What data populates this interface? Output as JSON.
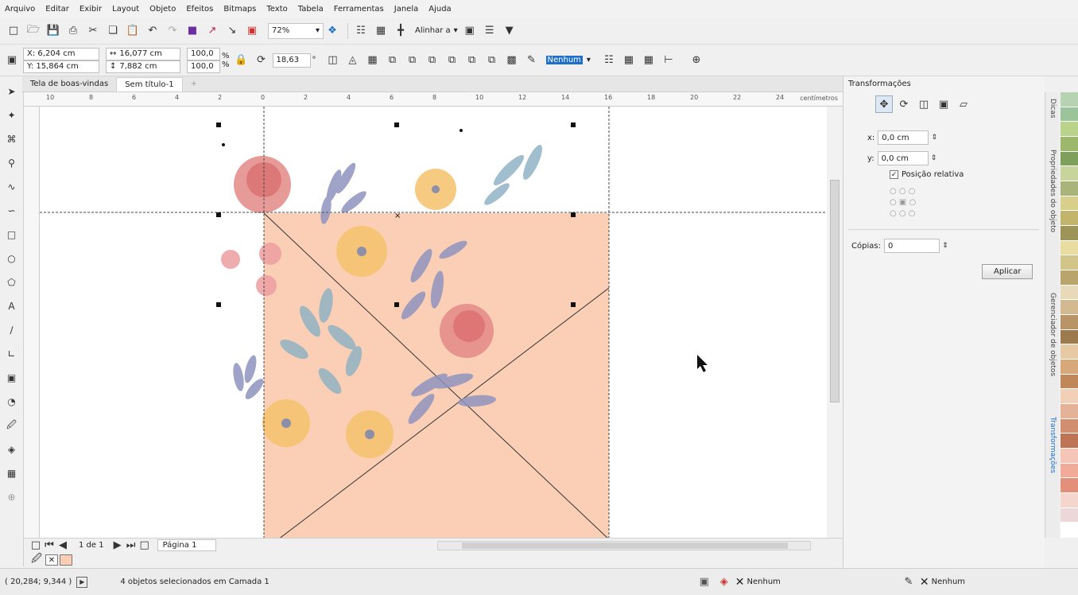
{
  "menu": [
    "Arquivo",
    "Editar",
    "Exibir",
    "Layout",
    "Objeto",
    "Efeitos",
    "Bitmaps",
    "Texto",
    "Tabela",
    "Ferramentas",
    "Janela",
    "Ajuda"
  ],
  "toolbar": {
    "zoom": "72%",
    "snap_label": "Alinhar a"
  },
  "props": {
    "x": "X: 6,204 cm",
    "y": "Y: 15,864 cm",
    "w": "16,077 cm",
    "h": "7,882 cm",
    "scale_w": "100,0",
    "scale_h": "100,0",
    "pct": "%",
    "rotation": "18,63",
    "deg": "°",
    "outline": "Nenhum"
  },
  "tabs": [
    "Tela de boas-vindas",
    "Sem título-1"
  ],
  "ruler": {
    "unit": "centímetros",
    "ticks": [
      "10",
      "8",
      "6",
      "4",
      "2",
      "0",
      "2",
      "4",
      "6",
      "8",
      "10",
      "12",
      "14",
      "16",
      "18",
      "20",
      "22",
      "24"
    ]
  },
  "page_nav": {
    "count": "1 de 1",
    "page_tab": "Página 1"
  },
  "docker": {
    "title": "Transformações",
    "x_label": "x:",
    "x_value": "0,0 cm",
    "y_label": "y:",
    "y_value": "0,0 cm",
    "relative_label": "Posição relativa",
    "copies_label": "Cópias:",
    "copies_value": "0",
    "apply": "Aplicar"
  },
  "side_tabs": [
    "Dicas",
    "Propriedades do objeto",
    "Gerenciador de objetos",
    "Transformações"
  ],
  "palette": [
    "#b5d3b0",
    "#9cc49a",
    "#b9d48a",
    "#9bb86c",
    "#7fa05a",
    "#c8d59a",
    "#a9b47a",
    "#d8d08a",
    "#c2b46b",
    "#9d9458",
    "#e8dca0",
    "#d3c487",
    "#b9a46b",
    "#e8d9b8",
    "#d2b98f",
    "#b89466",
    "#9d7a4d",
    "#e7c9a4",
    "#d6a87a",
    "#c08858",
    "#f2d0b8",
    "#e4b397",
    "#d18f6f",
    "#be7455",
    "#f5c6b8",
    "#f1ab98",
    "#e38f7a",
    "#f4d6cc",
    "#ecd8d8",
    "#ffffff"
  ],
  "status": {
    "coords": "( 20,284; 9,344 )",
    "message": "4 objetos selecionados em Camada 1",
    "fill": "Nenhum",
    "outline": "Nenhum"
  },
  "colors": {
    "paper": "#fbcfb5",
    "accent": "#1e6fc8"
  }
}
